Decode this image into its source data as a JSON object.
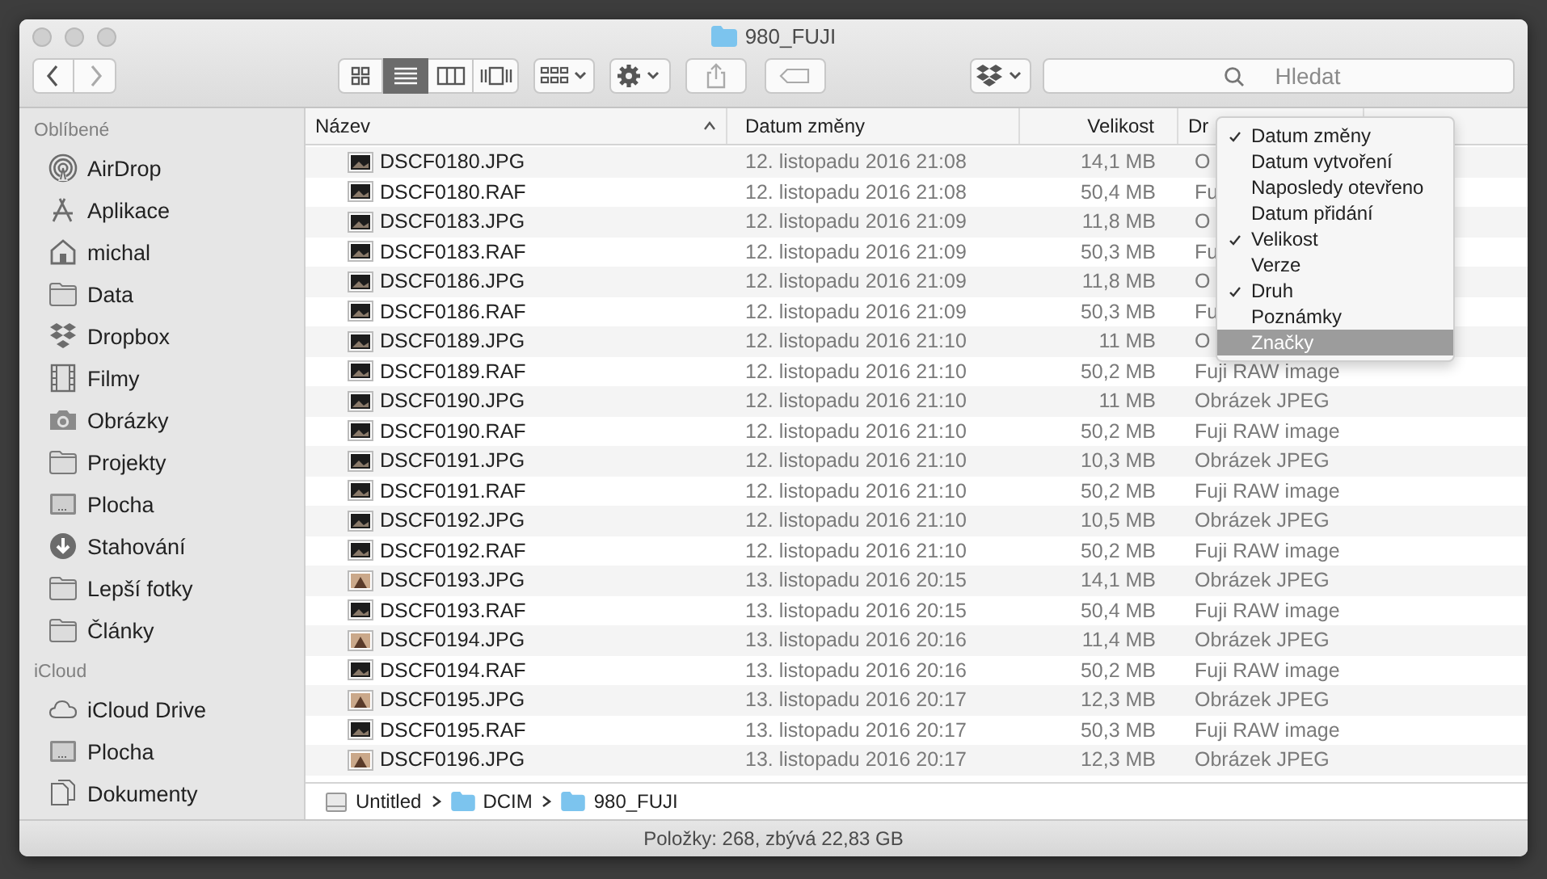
{
  "window": {
    "title": "980_FUJI"
  },
  "toolbar": {
    "view_modes": [
      {
        "kind": "icons",
        "selected": false
      },
      {
        "kind": "list",
        "selected": true
      },
      {
        "kind": "columns",
        "selected": false
      },
      {
        "kind": "gallery",
        "selected": false
      }
    ]
  },
  "search": {
    "placeholder": "Hledat"
  },
  "sidebar": {
    "sections": [
      {
        "title": "Oblíbené",
        "items": [
          {
            "label": "AirDrop",
            "kind": "airdrop"
          },
          {
            "label": "Aplikace",
            "kind": "apps"
          },
          {
            "label": "michal",
            "kind": "home"
          },
          {
            "label": "Data",
            "kind": "folder"
          },
          {
            "label": "Dropbox",
            "kind": "dropbox"
          },
          {
            "label": "Filmy",
            "kind": "film"
          },
          {
            "label": "Obrázky",
            "kind": "camera"
          },
          {
            "label": "Projekty",
            "kind": "folder"
          },
          {
            "label": "Plocha",
            "kind": "desktop"
          },
          {
            "label": "Stahování",
            "kind": "download"
          },
          {
            "label": "Lepší fotky",
            "kind": "folder"
          },
          {
            "label": "Články",
            "kind": "folder"
          }
        ]
      },
      {
        "title": "iCloud",
        "items": [
          {
            "label": "iCloud Drive",
            "kind": "cloud"
          },
          {
            "label": "Plocha",
            "kind": "desktop"
          },
          {
            "label": "Dokumenty",
            "kind": "documents"
          }
        ]
      }
    ]
  },
  "table": {
    "columns": [
      {
        "label": "Název",
        "sorted": true
      },
      {
        "label": "Datum změny",
        "sorted": false
      },
      {
        "label": "Velikost",
        "sorted": false
      },
      {
        "label": "Dr",
        "sorted": false
      }
    ],
    "rows": [
      {
        "name": "DSCF0180.JPG",
        "date": "12. listopadu 2016 21:08",
        "size": "14,1 MB",
        "kind": "O"
      },
      {
        "name": "DSCF0180.RAF",
        "date": "12. listopadu 2016 21:08",
        "size": "50,4 MB",
        "kind": "Fu"
      },
      {
        "name": "DSCF0183.JPG",
        "date": "12. listopadu 2016 21:09",
        "size": "11,8 MB",
        "kind": "O"
      },
      {
        "name": "DSCF0183.RAF",
        "date": "12. listopadu 2016 21:09",
        "size": "50,3 MB",
        "kind": "Fu"
      },
      {
        "name": "DSCF0186.JPG",
        "date": "12. listopadu 2016 21:09",
        "size": "11,8 MB",
        "kind": "O"
      },
      {
        "name": "DSCF0186.RAF",
        "date": "12. listopadu 2016 21:09",
        "size": "50,3 MB",
        "kind": "Fu"
      },
      {
        "name": "DSCF0189.JPG",
        "date": "12. listopadu 2016 21:10",
        "size": "11 MB",
        "kind": "O"
      },
      {
        "name": "DSCF0189.RAF",
        "date": "12. listopadu 2016 21:10",
        "size": "50,2 MB",
        "kind": "Fuji RAW image"
      },
      {
        "name": "DSCF0190.JPG",
        "date": "12. listopadu 2016 21:10",
        "size": "11 MB",
        "kind": "Obrázek JPEG"
      },
      {
        "name": "DSCF0190.RAF",
        "date": "12. listopadu 2016 21:10",
        "size": "50,2 MB",
        "kind": "Fuji RAW image"
      },
      {
        "name": "DSCF0191.JPG",
        "date": "12. listopadu 2016 21:10",
        "size": "10,3 MB",
        "kind": "Obrázek JPEG"
      },
      {
        "name": "DSCF0191.RAF",
        "date": "12. listopadu 2016 21:10",
        "size": "50,2 MB",
        "kind": "Fuji RAW image"
      },
      {
        "name": "DSCF0192.JPG",
        "date": "12. listopadu 2016 21:10",
        "size": "10,5 MB",
        "kind": "Obrázek JPEG"
      },
      {
        "name": "DSCF0192.RAF",
        "date": "12. listopadu 2016 21:10",
        "size": "50,2 MB",
        "kind": "Fuji RAW image"
      },
      {
        "name": "DSCF0193.JPG",
        "date": "13. listopadu 2016 20:15",
        "size": "14,1 MB",
        "kind": "Obrázek JPEG"
      },
      {
        "name": "DSCF0193.RAF",
        "date": "13. listopadu 2016 20:15",
        "size": "50,4 MB",
        "kind": "Fuji RAW image"
      },
      {
        "name": "DSCF0194.JPG",
        "date": "13. listopadu 2016 20:16",
        "size": "11,4 MB",
        "kind": "Obrázek JPEG"
      },
      {
        "name": "DSCF0194.RAF",
        "date": "13. listopadu 2016 20:16",
        "size": "50,2 MB",
        "kind": "Fuji RAW image"
      },
      {
        "name": "DSCF0195.JPG",
        "date": "13. listopadu 2016 20:17",
        "size": "12,3 MB",
        "kind": "Obrázek JPEG"
      },
      {
        "name": "DSCF0195.RAF",
        "date": "13. listopadu 2016 20:17",
        "size": "50,3 MB",
        "kind": "Fuji RAW image"
      },
      {
        "name": "DSCF0196.JPG",
        "date": "13. listopadu 2016 20:17",
        "size": "12,3 MB",
        "kind": "Obrázek JPEG"
      }
    ]
  },
  "column_menu": {
    "items": [
      {
        "label": "Datum změny",
        "checked": true,
        "selected": false
      },
      {
        "label": "Datum vytvoření",
        "checked": false,
        "selected": false
      },
      {
        "label": "Naposledy otevřeno",
        "checked": false,
        "selected": false
      },
      {
        "label": "Datum přidání",
        "checked": false,
        "selected": false
      },
      {
        "label": "Velikost",
        "checked": true,
        "selected": false
      },
      {
        "label": "Verze",
        "checked": false,
        "selected": false
      },
      {
        "label": "Druh",
        "checked": true,
        "selected": false
      },
      {
        "label": "Poznámky",
        "checked": false,
        "selected": false
      },
      {
        "label": "Značky",
        "checked": false,
        "selected": true
      }
    ]
  },
  "path_bar": [
    {
      "label": "Untitled",
      "kind": "disk"
    },
    {
      "label": "DCIM",
      "kind": "folder"
    },
    {
      "label": "980_FUJI",
      "kind": "folder"
    }
  ],
  "status_bar": {
    "text": "Položky: 268, zbývá 22,83 GB"
  }
}
